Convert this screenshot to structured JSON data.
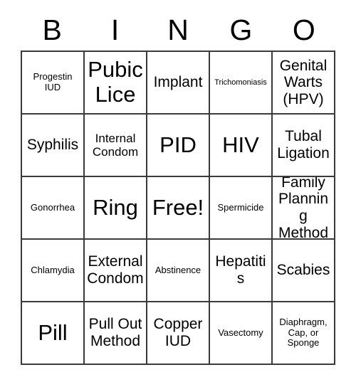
{
  "header": {
    "letters": [
      "B",
      "I",
      "N",
      "G",
      "O"
    ]
  },
  "grid": {
    "rows": [
      [
        {
          "text": "Progestin IUD",
          "size": "xs"
        },
        {
          "text": "Pubic Lice",
          "size": "xl"
        },
        {
          "text": "Implant",
          "size": "md"
        },
        {
          "text": "Trichomoniasis",
          "size": "xxs"
        },
        {
          "text": "Genital Warts (HPV)",
          "size": "md"
        }
      ],
      [
        {
          "text": "Syphilis",
          "size": "md"
        },
        {
          "text": "Internal Condom",
          "size": "sm"
        },
        {
          "text": "PID",
          "size": "xl"
        },
        {
          "text": "HIV",
          "size": "xl"
        },
        {
          "text": "Tubal Ligation",
          "size": "md"
        }
      ],
      [
        {
          "text": "Gonorrhea",
          "size": "xs"
        },
        {
          "text": "Ring",
          "size": "xl"
        },
        {
          "text": "Free!",
          "size": "xl"
        },
        {
          "text": "Spermicide",
          "size": "xs"
        },
        {
          "text": "Family Planning Method",
          "size": "md"
        }
      ],
      [
        {
          "text": "Chlamydia",
          "size": "xs"
        },
        {
          "text": "External Condom",
          "size": "md"
        },
        {
          "text": "Abstinence",
          "size": "xs"
        },
        {
          "text": "Hepatitis",
          "size": "md"
        },
        {
          "text": "Scabies",
          "size": "md"
        }
      ],
      [
        {
          "text": "Pill",
          "size": "xl"
        },
        {
          "text": "Pull Out Method",
          "size": "md"
        },
        {
          "text": "Copper IUD",
          "size": "md"
        },
        {
          "text": "Vasectomy",
          "size": "xs"
        },
        {
          "text": "Diaphragm, Cap, or Sponge",
          "size": "xs"
        }
      ]
    ]
  },
  "colors": {
    "border": "#3a3a3a",
    "text": "#000000",
    "background": "#ffffff"
  }
}
